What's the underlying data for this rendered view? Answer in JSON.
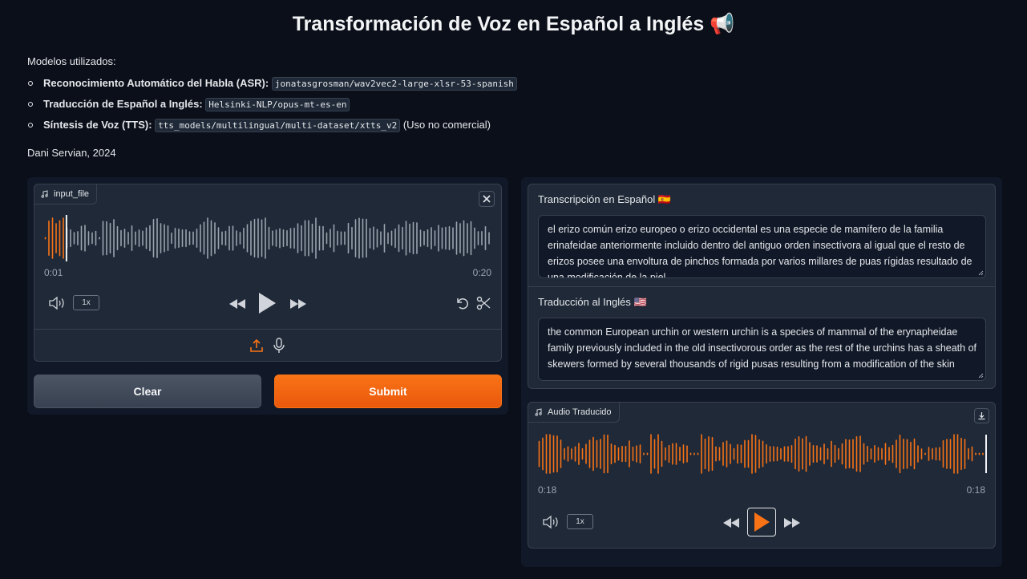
{
  "title": "Transformación de Voz en Español a Inglés 📢",
  "intro": {
    "models_heading": "Modelos utilizados:",
    "models": [
      {
        "label": "Reconocimiento Automático del Habla (ASR):",
        "code": "jonatasgrosman/wav2vec2-large-xlsr-53-spanish",
        "note": ""
      },
      {
        "label": "Traducción de Español a Inglés:",
        "code": "Helsinki-NLP/opus-mt-es-en",
        "note": ""
      },
      {
        "label": "Síntesis de Voz (TTS):",
        "code": "tts_models/multilingual/multi-dataset/xtts_v2",
        "note": "(Uso no comercial)"
      }
    ],
    "author": "Dani Servian, 2024"
  },
  "input_audio": {
    "label": "input_file",
    "time_current": "0:01",
    "time_total": "0:20",
    "playback_rate": "1x",
    "progress": 0.05
  },
  "buttons": {
    "clear": "Clear",
    "submit": "Submit"
  },
  "transcription": {
    "label": "Transcripción en Español 🇪🇸",
    "text": "el erizo común erizo europeo o erizo occidental es una especie de mamífero de la familia erinafeidae anteriormente incluido dentro del antiguo orden insectívora al igual que el resto de erizos posee una envoltura de pinchos formada por varios millares de puas rígidas resultado de una modificación de la piel"
  },
  "translation": {
    "label": "Traducción al Inglés 🇺🇸",
    "text": "the common European urchin or western urchin is a species of mammal of the erynapheidae family previously included in the old insectivorous order as the rest of the urchins has a sheath of skewers formed by several thousands of rigid pusas resulting from a modification of the skin"
  },
  "output_audio": {
    "label": "Audio Traducido",
    "time_current": "0:18",
    "time_total": "0:18",
    "playback_rate": "1x",
    "progress": 1.0
  },
  "colors": {
    "accent": "#f97316",
    "wave_inactive": "#9ca3af",
    "background": "#0b0f19"
  },
  "icons": [
    "music-note-icon",
    "close-icon",
    "volume-icon",
    "rewind-icon",
    "play-icon",
    "fast-forward-icon",
    "undo-icon",
    "scissors-icon",
    "upload-icon",
    "microphone-icon",
    "download-icon"
  ]
}
